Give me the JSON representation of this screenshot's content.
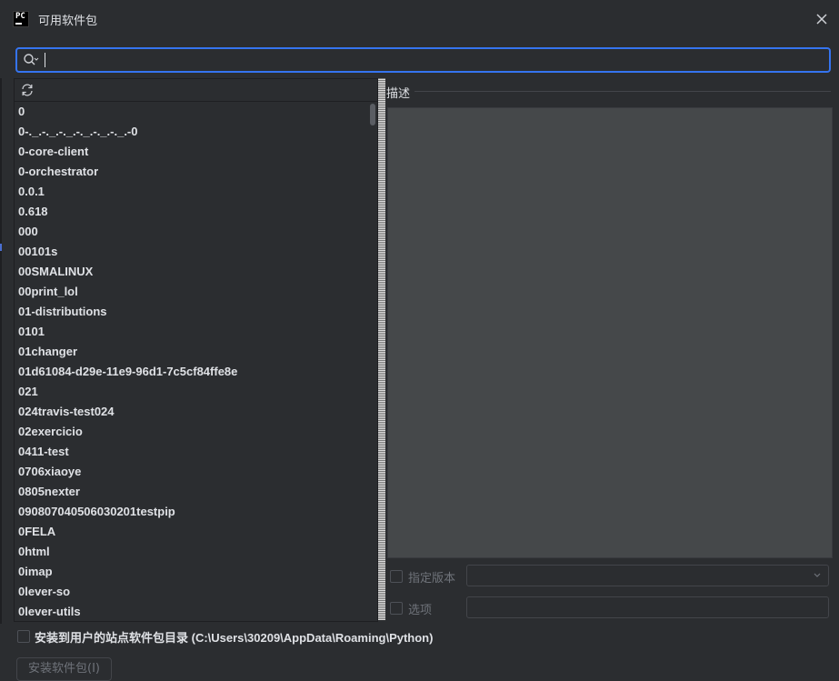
{
  "window": {
    "title": "可用软件包",
    "icon_text": "PC",
    "icon": "pycharm-icon",
    "close_icon": "close-icon"
  },
  "search": {
    "value": "",
    "placeholder": "",
    "icon": "search-icon"
  },
  "toolbar": {
    "refresh_icon": "refresh-icon"
  },
  "packages": [
    "0",
    "0-._.-._.-._.-._.-._.-._.-0",
    "0-core-client",
    "0-orchestrator",
    "0.0.1",
    "0.618",
    "000",
    "00101s",
    "00SMALINUX",
    "00print_lol",
    "01-distributions",
    "0101",
    "01changer",
    "01d61084-d29e-11e9-96d1-7c5cf84ffe8e",
    "021",
    "024travis-test024",
    "02exercicio",
    "0411-test",
    "0706xiaoye",
    "0805nexter",
    "090807040506030201testpip",
    "0FELA",
    "0html",
    "0imap",
    "0lever-so",
    "0lever-utils"
  ],
  "description": {
    "label": "描述"
  },
  "options": {
    "specify_version_label": "指定版本",
    "specify_version_checked": false,
    "options_label": "选项",
    "options_checked": false
  },
  "user_site": {
    "label": "安装到用户的站点软件包目录 (C:\\Users\\30209\\AppData\\Roaming\\Python)",
    "checked": false
  },
  "install_button": {
    "label": "安装软件包(I)"
  },
  "colors": {
    "background": "#2b2d30",
    "accent": "#3574f0",
    "description_bg": "#45484a"
  }
}
